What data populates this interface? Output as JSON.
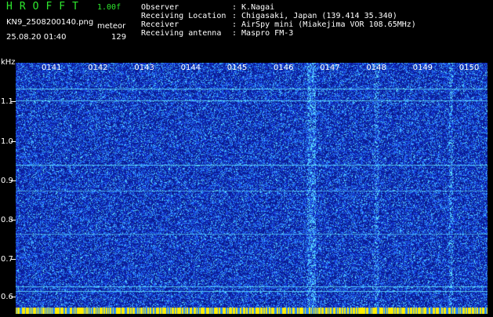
{
  "header": {
    "app_title": "HROFFT",
    "version": "1.00f",
    "filename": "KN9_2508200140.png",
    "mode": "meteor",
    "datetime": "25.08.20 01:40",
    "count": "129"
  },
  "info": [
    {
      "label": "Observer",
      "value": ": K.Nagai"
    },
    {
      "label": "Receiving Location",
      "value": ": Chigasaki, Japan (139.414 35.340)"
    },
    {
      "label": "Receiver",
      "value": ": AirSpy mini (Miakejima VOR 108.65MHz)"
    },
    {
      "label": "Receiving antenna",
      "value": ": Maspro FM-3"
    }
  ],
  "axis": {
    "unit": "kHz",
    "y_ticks": [
      "1.1",
      "1.0",
      "0.9",
      "0.8",
      "0.7",
      "0.6"
    ],
    "time_labels": [
      "0141",
      "0142",
      "0143",
      "0144",
      "0145",
      "0146",
      "0147",
      "0148",
      "0149",
      "0150"
    ]
  },
  "colors": {
    "background": "#0a1a8c",
    "noise": "#2a60ff",
    "highlight": "#60e0ff",
    "footer_yellow": "#ffee00"
  }
}
